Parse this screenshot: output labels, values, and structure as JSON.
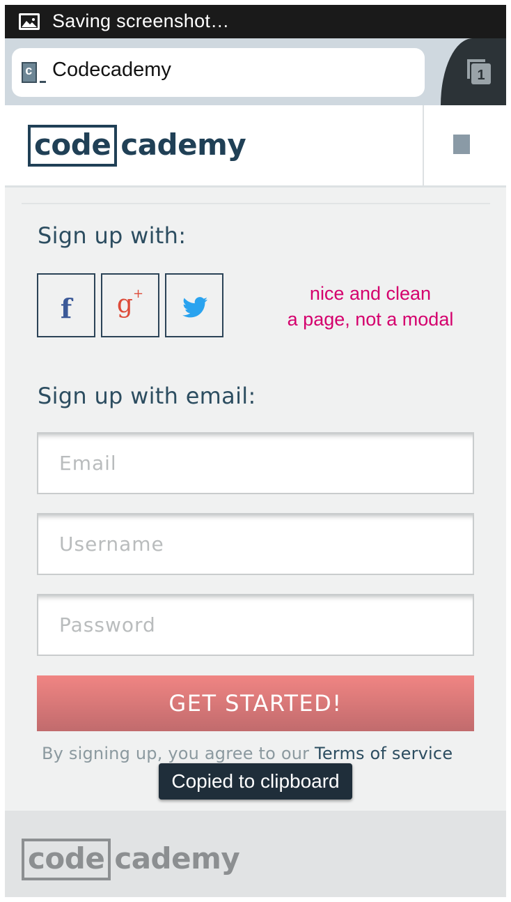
{
  "status_bar": {
    "text": "Saving screenshot…",
    "icon": "image-icon"
  },
  "browser": {
    "tab_title": "Codecademy",
    "tab_count": "1",
    "favicon_letter": "c"
  },
  "header": {
    "logo_box": "code",
    "logo_rest": "cademy"
  },
  "signup": {
    "social_heading": "Sign up with:",
    "facebook_glyph": "f",
    "google_glyph": "g",
    "google_plus": "+",
    "email_heading": "Sign up with email:",
    "email_placeholder": "Email",
    "username_placeholder": "Username",
    "password_placeholder": "Password",
    "cta_label": "GET STARTED!",
    "terms_prefix": "By signing up, you agree to our ",
    "terms_link": "Terms of service"
  },
  "annotation": {
    "line1": "nice and clean",
    "line2": "a page, not a modal"
  },
  "toast": {
    "text": "Copied to clipboard"
  },
  "footer": {
    "logo_box": "code",
    "logo_rest": "cademy"
  },
  "colors": {
    "accent_red": "#f08583",
    "brand_navy": "#204056",
    "annotation_pink": "#d4006d"
  }
}
